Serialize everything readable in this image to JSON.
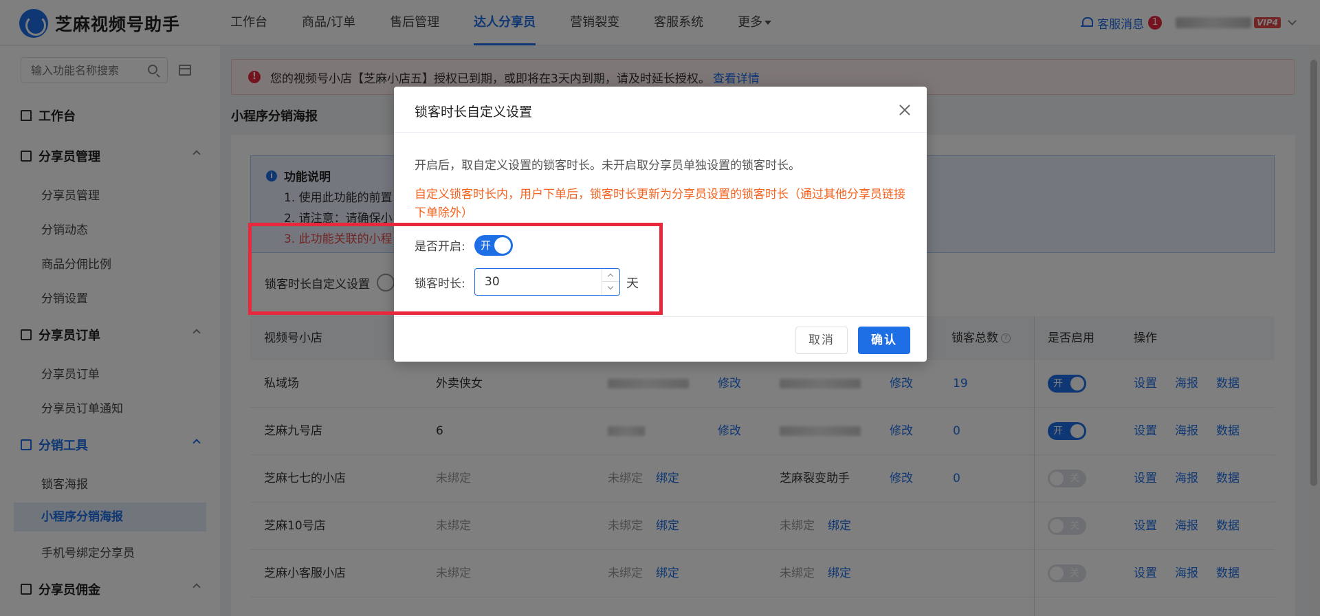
{
  "app": {
    "title": "芝麻视频号助手"
  },
  "nav": {
    "items": [
      "工作台",
      "商品/订单",
      "售后管理",
      "达人分享员",
      "营销裂变",
      "客服系统",
      "更多"
    ],
    "active_index": 3,
    "message_label": "客服消息",
    "message_count": "1",
    "vip_label": "VIP4"
  },
  "sidebar": {
    "search_placeholder": "输入功能名称搜索",
    "home": "工作台",
    "groups": [
      {
        "label": "分享员管理",
        "items": [
          "分享员管理",
          "分销动态",
          "商品分佣比例",
          "分销设置"
        ]
      },
      {
        "label": "分享员订单",
        "items": [
          "分享员订单",
          "分享员订单通知"
        ]
      },
      {
        "label": "分销工具",
        "items": [
          "锁客海报",
          "小程序分销海报",
          "手机号绑定分享员"
        ],
        "active_item": 1
      },
      {
        "label": "分享员佣金",
        "items": []
      }
    ]
  },
  "alert": {
    "text": "您的视频号小店【芝麻小店五】授权已到期，或即将在3天内到期，请及时延长授权。",
    "link": "查看详情"
  },
  "page": {
    "title": "小程序分销海报",
    "notice_title": "功能说明",
    "notice_lines": [
      "1. 使用此功能的前置",
      "2. 请注意：请确保小",
      "3. 此功能关联的小程"
    ],
    "lock_setting_label": "锁客时长自定义设置"
  },
  "table": {
    "columns": [
      "视频号小店",
      "锁客总数",
      "是否启用",
      "操作"
    ],
    "rows": [
      {
        "shop": "私域场",
        "col2": "外卖侠女",
        "edit1": "修改",
        "edit2": "修改",
        "total": "19",
        "enabled": true,
        "enabled_label": "开"
      },
      {
        "shop": "芝麻九号店",
        "col2": "6",
        "edit1": "修改",
        "edit2": "修改",
        "total": "0",
        "enabled": true,
        "enabled_label": "开"
      },
      {
        "shop": "芝麻七七的小店",
        "col2": "未绑定",
        "col3": "未绑定",
        "bind3": "绑定",
        "col4": "芝麻裂变助手",
        "edit2": "修改",
        "total": "0",
        "enabled": false,
        "enabled_label": "关"
      },
      {
        "shop": "芝麻10号店",
        "col2": "未绑定",
        "col3": "未绑定",
        "bind3": "绑定",
        "col4": "未绑定",
        "bind4": "绑定",
        "enabled": false,
        "enabled_label": "关"
      },
      {
        "shop": "芝麻小客服小店",
        "col2": "未绑定",
        "col3": "未绑定",
        "bind3": "绑定",
        "col4": "未绑定",
        "bind4": "绑定",
        "enabled": false,
        "enabled_label": "关"
      }
    ],
    "actions": [
      "设置",
      "海报",
      "数据"
    ]
  },
  "modal": {
    "title": "锁客时长自定义设置",
    "desc": "开启后，取自定义设置的锁客时长。未开启取分享员单独设置的锁客时长。",
    "warning": "自定义锁客时长内，用户下单后，锁客时长更新为分享员设置的锁客时长（通过其他分享员链接下单除外）",
    "enable_label": "是否开启:",
    "enable_switch_label": "开",
    "duration_label": "锁客时长:",
    "duration_value": "30",
    "unit": "天",
    "cancel": "取消",
    "confirm": "确认"
  },
  "colors": {
    "primary": "#1e6fe6",
    "danger": "#e8283c",
    "warning_text": "#f5621e"
  }
}
